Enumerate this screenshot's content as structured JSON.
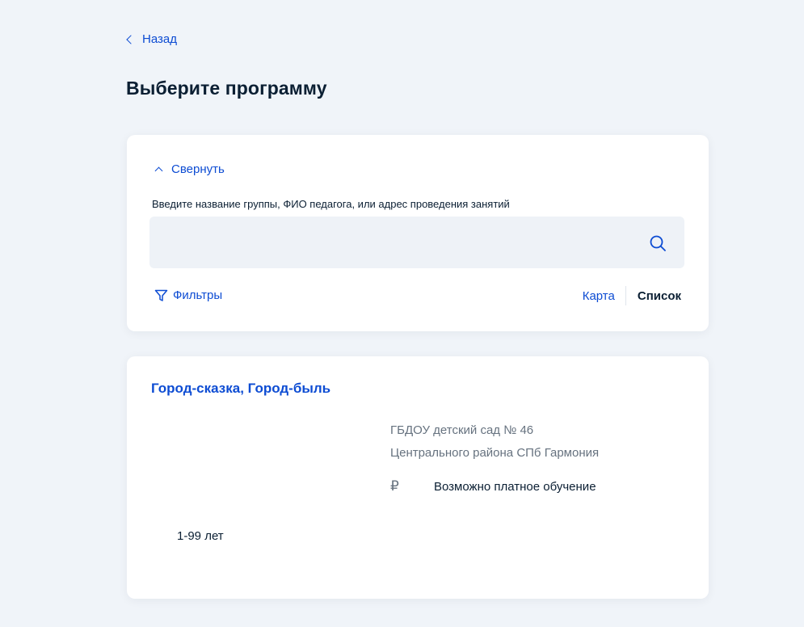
{
  "nav": {
    "back_label": "Назад"
  },
  "page": {
    "title": "Выберите программу"
  },
  "search": {
    "collapse_label": "Свернуть",
    "label": "Введите название группы, ФИО педагога, или адрес проведения занятий",
    "value": "",
    "placeholder": "",
    "filters_label": "Фильтры",
    "view_map_label": "Карта",
    "view_list_label": "Список",
    "active_view": "Список"
  },
  "results": [
    {
      "title": "Город-сказка, Город-быль",
      "org_line1": "ГБДОУ детский сад № 46",
      "org_line2": "Центрального района СПб Гармония",
      "payment_icon": "₽",
      "payment_text": "Возможно платное обучение",
      "age": "1-99 лет"
    }
  ],
  "colors": {
    "background": "#f0f4f9",
    "accent": "#0d4cd3",
    "text": "#0b1f33",
    "muted": "#66727f",
    "input_bg": "#eef2f7"
  },
  "icons": {
    "back": "chevron-left-icon",
    "collapse": "chevron-up-icon",
    "search": "search-icon",
    "filter": "filter-icon",
    "payment": "ruble-icon"
  }
}
